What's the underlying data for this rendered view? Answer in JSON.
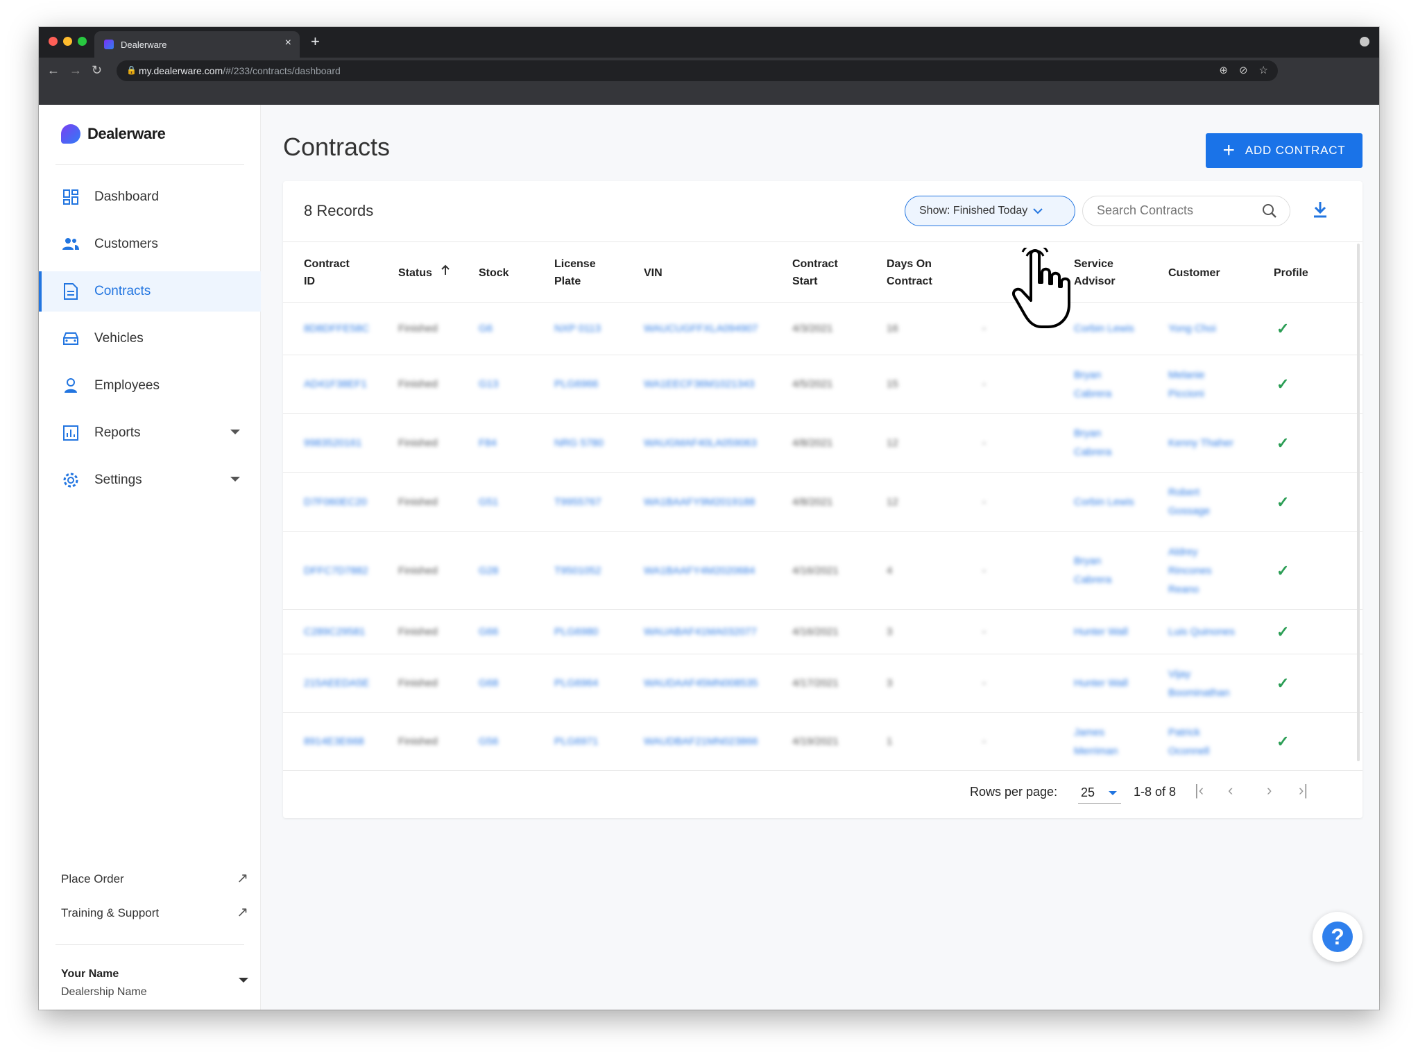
{
  "browser": {
    "tab_title": "Dealerware",
    "tab_close": "×",
    "new_tab": "+",
    "url_host": "my.dealerware.com",
    "url_path": "/#/233/contracts/dashboard"
  },
  "sidebar": {
    "brand": "Dealerware",
    "items": [
      {
        "label": "Dashboard",
        "icon": "dashboard-icon"
      },
      {
        "label": "Customers",
        "icon": "customers-icon"
      },
      {
        "label": "Contracts",
        "icon": "contracts-icon",
        "active": true
      },
      {
        "label": "Vehicles",
        "icon": "vehicle-icon"
      },
      {
        "label": "Employees",
        "icon": "employee-icon"
      },
      {
        "label": "Reports",
        "icon": "reports-icon",
        "expandable": true
      },
      {
        "label": "Settings",
        "icon": "settings-icon",
        "expandable": true
      }
    ],
    "links": [
      {
        "label": "Place Order",
        "icon": "external-link-icon"
      },
      {
        "label": "Training & Support",
        "icon": "external-link-icon"
      }
    ],
    "user": {
      "name": "Your Name",
      "dealership": "Dealership Name"
    }
  },
  "page": {
    "title": "Contracts",
    "add_button": "ADD CONTRACT",
    "records": "8 Records",
    "filter_label": "Show: Finished Today",
    "search_placeholder": "Search Contracts"
  },
  "table": {
    "columns": {
      "contract_id": [
        "Contract",
        "ID"
      ],
      "status": "Status",
      "stock": "Stock",
      "license_plate": [
        "License",
        "Plate"
      ],
      "vin": "VIN",
      "contract_start": [
        "Contract",
        "Start"
      ],
      "days_on_contract": [
        "Days On",
        "Contract"
      ],
      "service_advisor": [
        "Service",
        "Advisor"
      ],
      "customer": "Customer",
      "profile": "Profile"
    },
    "rows": [
      {
        "id": "8D8DFFE58C",
        "status": "Finished",
        "stock": "G6",
        "plate": "NXP 0113",
        "vin": "WAUCUGFFXLA094907",
        "start": "4/3/2021",
        "days": "16",
        "blank": "-",
        "advisor": [
          "Corbin Lewis"
        ],
        "customer": [
          "Yong Choi"
        ],
        "profile": "✓"
      },
      {
        "id": "AD41F38EF1",
        "status": "Finished",
        "stock": "G13",
        "plate": "PLG6966",
        "vin": "WA1EECF36M1021343",
        "start": "4/5/2021",
        "days": "15",
        "blank": "-",
        "advisor": [
          "Bryan",
          "Cabrera"
        ],
        "customer": [
          "Melanie",
          "Piccioni"
        ],
        "profile": "✓"
      },
      {
        "id": "9983520161",
        "status": "Finished",
        "stock": "F84",
        "plate": "NRG 5780",
        "vin": "WAUGMAF40LA059063",
        "start": "4/8/2021",
        "days": "12",
        "blank": "-",
        "advisor": [
          "Bryan",
          "Cabrera"
        ],
        "customer": [
          "Kenny Thaher"
        ],
        "profile": "✓"
      },
      {
        "id": "D7F060EC20",
        "status": "Finished",
        "stock": "G51",
        "plate": "T9955767",
        "vin": "WA1BAAFY9M2019188",
        "start": "4/8/2021",
        "days": "12",
        "blank": "-",
        "advisor": [
          "Corbin Lewis"
        ],
        "customer": [
          "Robert",
          "Gossage"
        ],
        "profile": "✓"
      },
      {
        "id": "DFFC7D7882",
        "status": "Finished",
        "stock": "G28",
        "plate": "T9501052",
        "vin": "WA1BAAFY4M2020684",
        "start": "4/16/2021",
        "days": "4",
        "blank": "-",
        "advisor": [
          "Bryan",
          "Cabrera"
        ],
        "customer": [
          "Aldrey",
          "Rincones",
          "Reano"
        ],
        "profile": "✓"
      },
      {
        "id": "C289C29581",
        "status": "Finished",
        "stock": "G66",
        "plate": "PLG6980",
        "vin": "WAUABAF41MA032077",
        "start": "4/16/2021",
        "days": "3",
        "blank": "-",
        "advisor": [
          "Hunter Wall"
        ],
        "customer": [
          "Luis Quinones"
        ],
        "profile": "✓"
      },
      {
        "id": "215AEEDA5E",
        "status": "Finished",
        "stock": "G68",
        "plate": "PLG6964",
        "vin": "WAUDAAF45MN008535",
        "start": "4/17/2021",
        "days": "3",
        "blank": "-",
        "advisor": [
          "Hunter Wall"
        ],
        "customer": [
          "Vijay",
          "Boominathan"
        ],
        "profile": "✓"
      },
      {
        "id": "8914E3E668",
        "status": "Finished",
        "stock": "G56",
        "plate": "PLG6971",
        "vin": "WAUDBAF21MN023866",
        "start": "4/19/2021",
        "days": "1",
        "blank": "-",
        "advisor": [
          "James",
          "Merriman"
        ],
        "customer": [
          "Patrick",
          "Oconnell"
        ],
        "profile": "✓"
      }
    ]
  },
  "pagination": {
    "rows_per_page_label": "Rows per page:",
    "rows_per_page": "25",
    "range": "1-8 of 8"
  },
  "help": {
    "label": "?"
  },
  "colors": {
    "accent": "#1a73e8",
    "active_bg": "#eef5fe",
    "check": "#2a9d54"
  }
}
